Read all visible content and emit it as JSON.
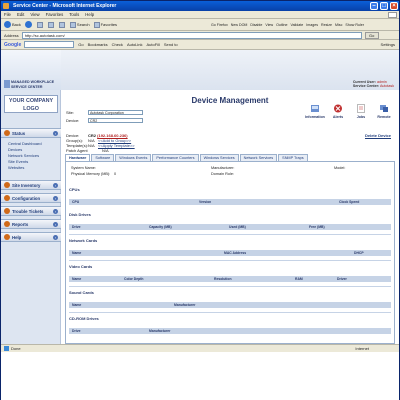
{
  "window": {
    "title": "Service Center - Microsoft Internet Explorer"
  },
  "menu": [
    "File",
    "Edit",
    "View",
    "Favorites",
    "Tools",
    "Help"
  ],
  "toolbar": {
    "back": "Back",
    "forward": "",
    "search": "Search",
    "favorites": "Favorites"
  },
  "google_toolbar": [
    "Go Firefox",
    "New DOM",
    "Disable",
    "View",
    "Outline",
    "Validate",
    "Images",
    "Resize",
    "Misc",
    "Show Ruler"
  ],
  "address": {
    "label": "Address",
    "value": "http://sc.autotask.com/",
    "go": "Go"
  },
  "google2": {
    "logo": "Google",
    "items": [
      "Go",
      "Bookmarks",
      "Check",
      "AutoLink",
      "AutoFill",
      "Send to"
    ],
    "settings": "Settings"
  },
  "brand": {
    "line1": "MANAGED WORKPLACE",
    "line2": "SERVICE CENTER"
  },
  "current": {
    "user_label": "Current User:",
    "user": "admin",
    "center_label": "Service Center:",
    "center": "Autotask"
  },
  "logo_text": [
    "YOUR COMPANY",
    "LOGO"
  ],
  "nav": {
    "status": "Status",
    "status_items": [
      "Central Dashboard",
      "Devices",
      "Network Services",
      "Site Events",
      "Websites"
    ],
    "sections": [
      "Site Inventory",
      "Configuration",
      "Trouble Tickets",
      "Reports",
      "Help"
    ]
  },
  "page_title": "Device Management",
  "form": {
    "site_label": "Site:",
    "site_value": "Autotask Corporation",
    "device_label": "Device:",
    "device_value": "CR2"
  },
  "actions": [
    "Information",
    "Alerts",
    "Jobs",
    "Remote"
  ],
  "delete": "Delete Device",
  "device": {
    "device_label": "Device:",
    "device_name": "CR2",
    "device_ip": "(192.168.60.236)",
    "group_label": "Group(s):",
    "group_value": "N/A",
    "group_link": "<<Add to Group>>",
    "template_label": "Template(s):",
    "template_value": "N/A",
    "template_link": "<<Apply Template>>",
    "patch_label": "Patch Agent Setting(s):",
    "patch_value": "N/A"
  },
  "tabs": [
    "Hardware",
    "Software",
    "Windows Events",
    "Performance Counters",
    "Windows Services",
    "Network Services",
    "SNMP Traps"
  ],
  "hardware": {
    "system_name": "System Name:",
    "physical_memory": "Physical Memory (MB):",
    "physical_memory_value": "0",
    "manufacturer": "Manufacturer:",
    "domain_role": "Domain Role:",
    "model": "Model:",
    "cpus": "CPUs",
    "cpu_cols": [
      "CPU",
      "Version",
      "Clock Speed"
    ],
    "disk": "Disk Drives",
    "disk_cols": [
      "Drive",
      "Capacity (MB)",
      "Used (MB)",
      "Free (MB)"
    ],
    "network": "Network Cards",
    "network_cols": [
      "Name",
      "MAC Address",
      "DHCP"
    ],
    "video": "Video Cards",
    "video_cols": [
      "Name",
      "Color Depth",
      "Resolution",
      "RAM",
      "Driver"
    ],
    "sound": "Sound Cards",
    "sound_cols": [
      "Name",
      "Manufacturer"
    ],
    "cdrom": "CD-ROM Drives",
    "cdrom_cols": [
      "Drive",
      "Manufacturer"
    ]
  },
  "status": {
    "text": "Done",
    "zone": "Internet"
  },
  "colors": {
    "titlebar": "#0a5fd8",
    "nav_text": "#1f3c7a",
    "ip_red": "#b02020"
  }
}
